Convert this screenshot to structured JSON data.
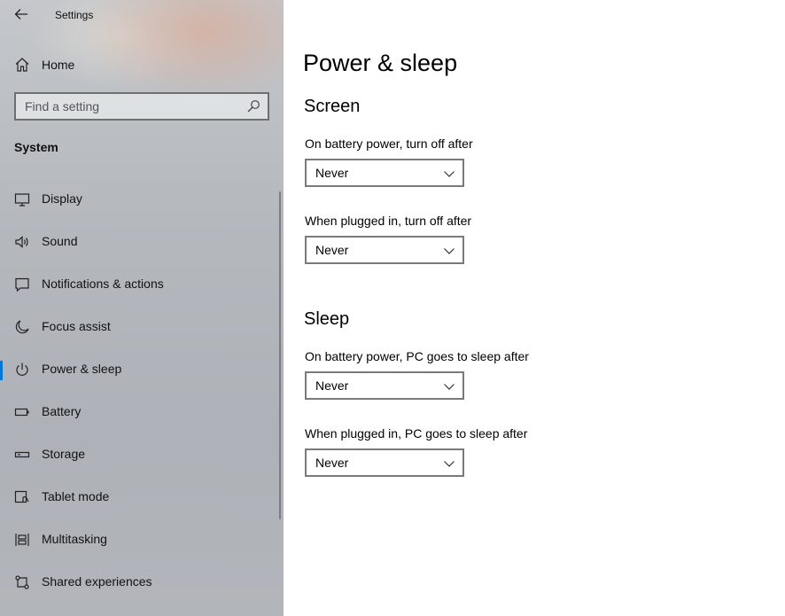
{
  "window": {
    "title": "Settings"
  },
  "sidebar": {
    "home_label": "Home",
    "search_placeholder": "Find a setting",
    "section_label": "System",
    "items": [
      {
        "label": "Display",
        "icon": "display-icon"
      },
      {
        "label": "Sound",
        "icon": "speaker-icon"
      },
      {
        "label": "Notifications & actions",
        "icon": "notification-icon"
      },
      {
        "label": "Focus assist",
        "icon": "moon-icon"
      },
      {
        "label": "Power & sleep",
        "icon": "power-icon",
        "selected": true
      },
      {
        "label": "Battery",
        "icon": "battery-icon"
      },
      {
        "label": "Storage",
        "icon": "storage-icon"
      },
      {
        "label": "Tablet mode",
        "icon": "tablet-mode-icon"
      },
      {
        "label": "Multitasking",
        "icon": "multitasking-icon"
      },
      {
        "label": "Shared experiences",
        "icon": "shared-experiences-icon"
      }
    ],
    "accent_color": "#0078d7"
  },
  "main": {
    "title": "Power & sleep",
    "screen": {
      "title": "Screen",
      "battery_label": "On battery power, turn off after",
      "battery_value": "Never",
      "plugged_label": "When plugged in, turn off after",
      "plugged_value": "Never"
    },
    "sleep": {
      "title": "Sleep",
      "battery_label": "On battery power, PC goes to sleep after",
      "battery_value": "Never",
      "plugged_label": "When plugged in, PC goes to sleep after",
      "plugged_value": "Never"
    }
  }
}
